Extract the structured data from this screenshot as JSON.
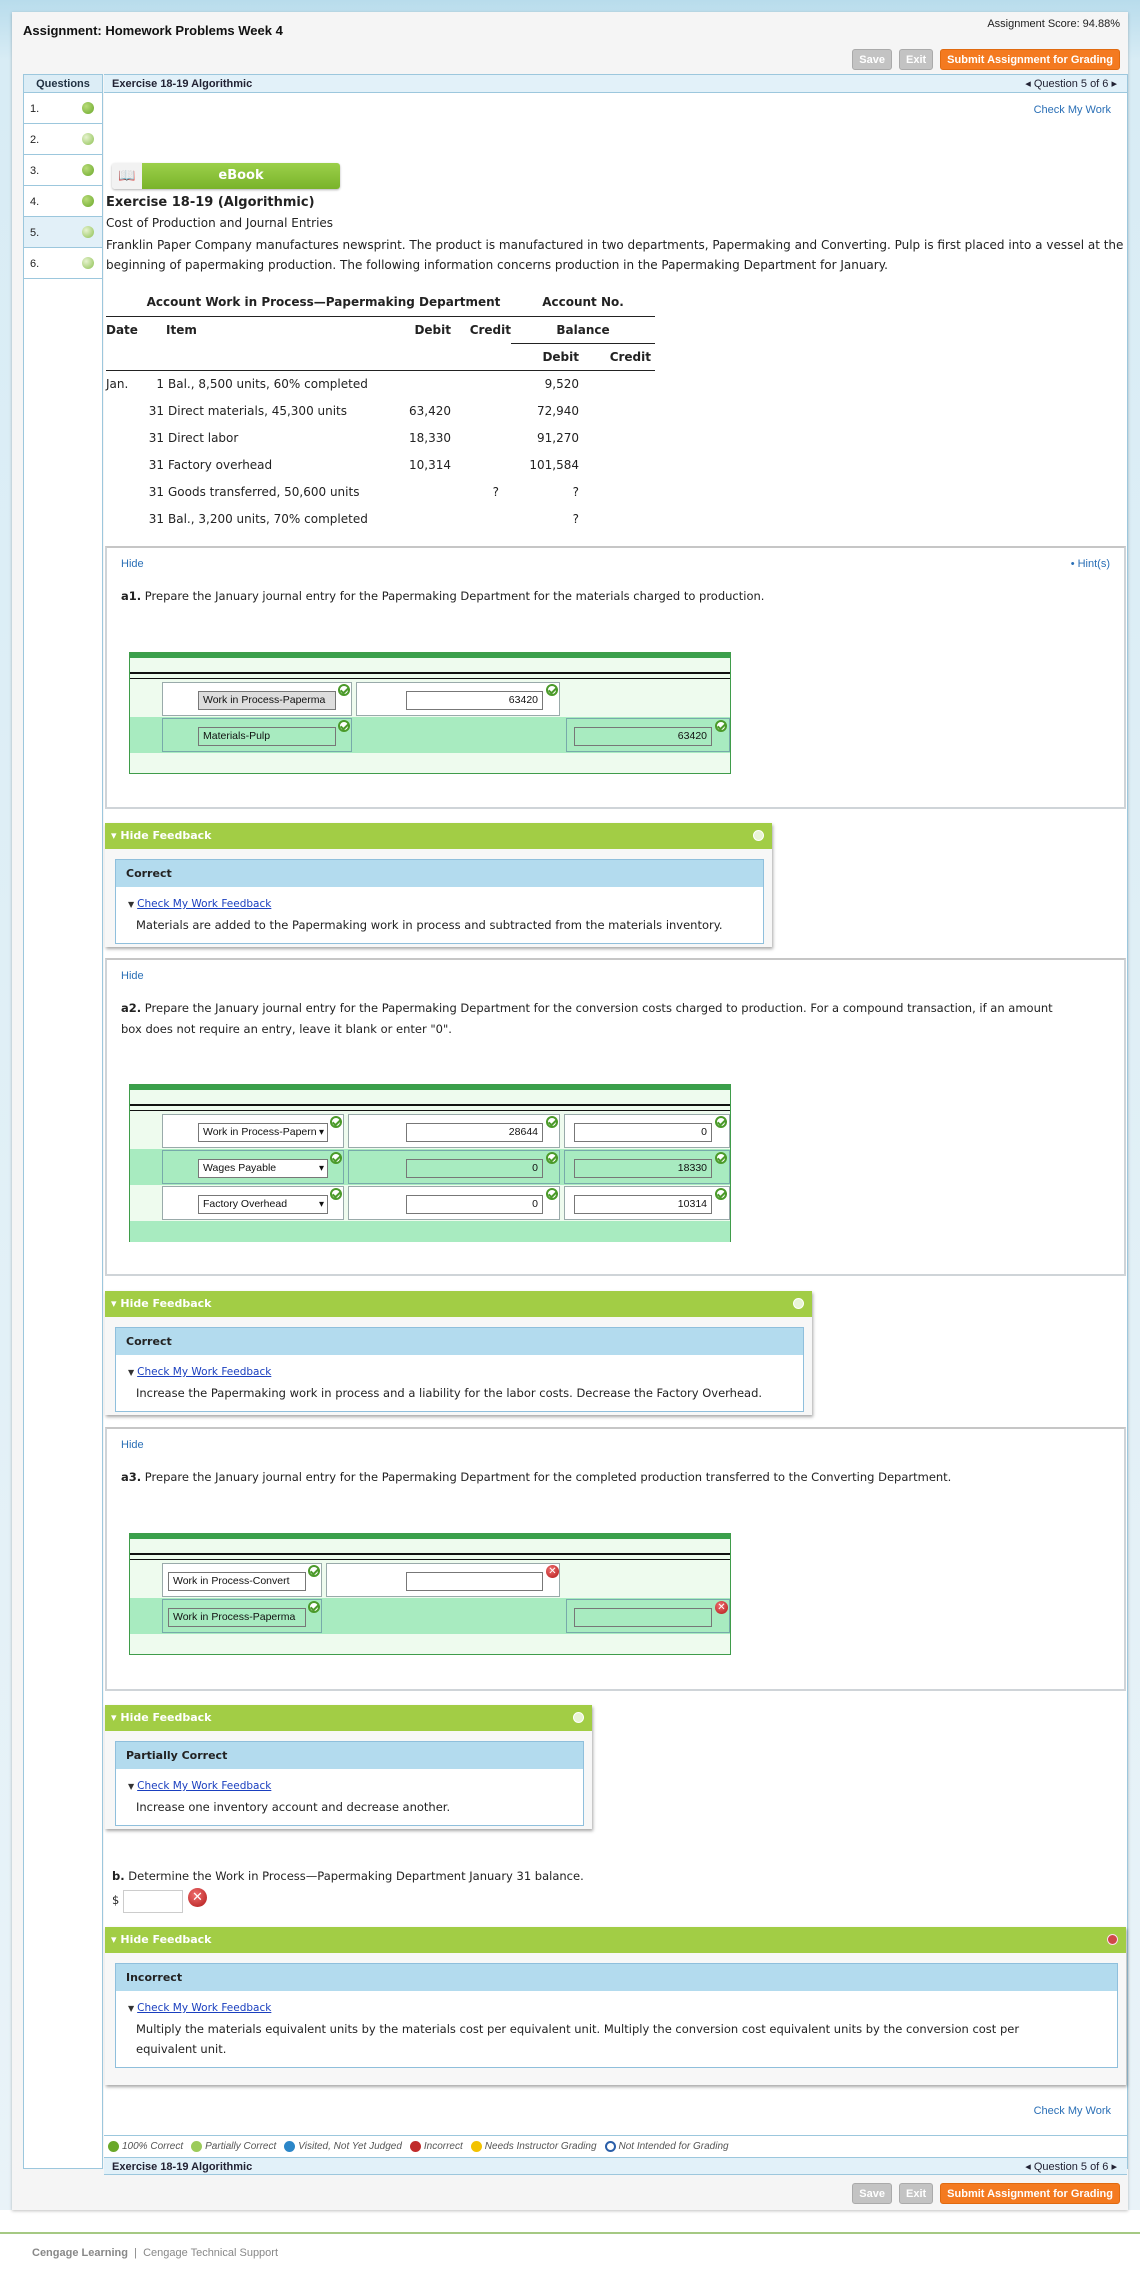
{
  "assignment_title": "Assignment: Homework Problems Week 4",
  "assignment_score": "Assignment Score: 94.88%",
  "toolbar": {
    "save_label": "Save",
    "exit_label": "Exit",
    "submit_label": "Submit Assignment for Grading"
  },
  "sidebar": {
    "header": "Questions",
    "items": [
      {
        "label": "1.",
        "status": "100% Correct"
      },
      {
        "label": "2.",
        "status": "Partially Correct"
      },
      {
        "label": "3.",
        "status": "100% Correct"
      },
      {
        "label": "4.",
        "status": "100% Correct"
      },
      {
        "label": "5.",
        "status": "Partially Correct",
        "active": true
      },
      {
        "label": "6.",
        "status": "Partially Correct"
      }
    ]
  },
  "header": {
    "exercise": "Exercise 18-19 Algorithmic",
    "question_nav": "Question 5 of 6",
    "check_my_work": "Check My Work"
  },
  "ebook_label": "eBook",
  "exercise": {
    "title": "Exercise 18-19 (Algorithmic)",
    "subtitle": "Cost of Production and Journal Entries",
    "intro_line1": "Franklin Paper Company manufactures newsprint. The product is manufactured in two departments, Papermaking and Converting. Pulp is first placed into a vessel at the",
    "intro_line2": "beginning of papermaking production. The following information concerns production in the Papermaking Department for January."
  },
  "ledger": {
    "account_title": "Account Work in Process—Papermaking Department",
    "account_no": "Account No.",
    "headers": {
      "date": "Date",
      "item": "Item",
      "debit": "Debit",
      "credit": "Credit",
      "balance": "Balance",
      "bal_debit": "Debit",
      "bal_credit": "Credit"
    },
    "rows": [
      {
        "month": "Jan.",
        "day": "1",
        "item": "Bal., 8,500 units, 60% completed",
        "debit": "",
        "credit": "",
        "bal_debit": "9,520",
        "bal_credit": ""
      },
      {
        "month": "",
        "day": "31",
        "item": "Direct materials, 45,300 units",
        "debit": "63,420",
        "credit": "",
        "bal_debit": "72,940",
        "bal_credit": ""
      },
      {
        "month": "",
        "day": "31",
        "item": "Direct labor",
        "debit": "18,330",
        "credit": "",
        "bal_debit": "91,270",
        "bal_credit": ""
      },
      {
        "month": "",
        "day": "31",
        "item": "Factory overhead",
        "debit": "10,314",
        "credit": "",
        "bal_debit": "101,584",
        "bal_credit": ""
      },
      {
        "month": "",
        "day": "31",
        "item": "Goods transferred, 50,600 units",
        "debit": "",
        "credit": "?",
        "bal_debit": "?",
        "bal_credit": ""
      },
      {
        "month": "",
        "day": "31",
        "item": "Bal., 3,200 units, 70% completed",
        "debit": "",
        "credit": "",
        "bal_debit": "?",
        "bal_credit": ""
      }
    ]
  },
  "hide_label": "Hide",
  "hints_label": "Hint(s)",
  "a1": {
    "label": "a1.",
    "prompt": "Prepare the January journal entry for the Papermaking Department for the materials charged to production.",
    "entries": [
      {
        "account": "Work in Process-Paperma",
        "debit": "63420",
        "credit": null
      },
      {
        "account": "Materials-Pulp",
        "debit": null,
        "credit": "63420"
      }
    ],
    "feedback": {
      "toggle": "Hide Feedback",
      "status": "Correct",
      "link": "Check My Work Feedback",
      "text": "Materials are added to the Papermaking work in process and subtracted from the materials inventory."
    }
  },
  "a2": {
    "label": "a2.",
    "prompt_line1": "Prepare the January journal entry for the Papermaking Department for the conversion costs charged to production. For a compound transaction, if an amount",
    "prompt_line2": "box does not require an entry, leave it blank or enter \"0\".",
    "entries": [
      {
        "account": "Work in Process-Papern",
        "debit": "28644",
        "credit": "0"
      },
      {
        "account": "Wages Payable",
        "debit": "0",
        "credit": "18330"
      },
      {
        "account": "Factory Overhead",
        "debit": "0",
        "credit": "10314"
      }
    ],
    "feedback": {
      "toggle": "Hide Feedback",
      "status": "Correct",
      "link": "Check My Work Feedback",
      "text": "Increase the Papermaking work in process and a liability for the labor costs. Decrease the Factory Overhead."
    }
  },
  "a3": {
    "label": "a3.",
    "prompt": "Prepare the January journal entry for the Papermaking Department for the completed production transferred to the Converting Department.",
    "entries": [
      {
        "account": "Work in Process-Convert",
        "debit": "",
        "credit": null
      },
      {
        "account": "Work in Process-Paperma",
        "debit": null,
        "credit": ""
      }
    ],
    "feedback": {
      "toggle": "Hide Feedback",
      "status": "Partially Correct",
      "link": "Check My Work Feedback",
      "text": "Increase one inventory account and decrease another."
    }
  },
  "b": {
    "label": "b.",
    "prompt": "Determine the Work in Process—Papermaking Department January 31 balance.",
    "currency": "$",
    "value": "",
    "feedback": {
      "toggle": "Hide Feedback",
      "status": "Incorrect",
      "link": "Check My Work Feedback",
      "text_line1": "Multiply the materials equivalent units by the materials cost per equivalent unit. Multiply the conversion cost equivalent units by the conversion cost per",
      "text_line2": "equivalent unit."
    }
  },
  "legend": [
    {
      "label": "100% Correct",
      "color": "#6aa82a"
    },
    {
      "label": "Partially Correct",
      "color": "#9ccb5a"
    },
    {
      "label": "Visited, Not Yet Judged",
      "color": "#2b86c8"
    },
    {
      "label": "Incorrect",
      "color": "#c02a2a"
    },
    {
      "label": "Needs Instructor Grading",
      "color": "#f2c200"
    },
    {
      "label": "Not Intended for Grading",
      "color": "#2a5ea8"
    }
  ],
  "footer": {
    "brand": "Cengage Learning",
    "support": "Cengage Technical Support"
  },
  "colors": {
    "accent_orange": "#f47a20",
    "feedback_green": "#a2cd45",
    "link_blue": "#2a6fb6",
    "journal_green": "#3aa04b"
  }
}
